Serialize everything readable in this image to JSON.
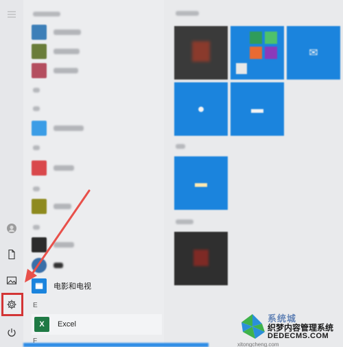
{
  "start_menu": {
    "app_list": {
      "letter_e": "E",
      "letter_f": "F",
      "items": [
        {
          "label": "",
          "icon": "app-icon",
          "color": "#3d7fb8"
        },
        {
          "label": "",
          "icon": "app-icon",
          "color": "#6a7d3a"
        },
        {
          "label": "",
          "icon": "app-icon",
          "color": "#b44e5f"
        },
        {
          "label": "",
          "icon": "app-icon",
          "color": "#3b9de6"
        },
        {
          "label": "",
          "icon": "app-icon",
          "color": "#d9484c"
        },
        {
          "label": "",
          "icon": "app-icon",
          "color": "#8e8a1e"
        },
        {
          "label": "",
          "icon": "app-icon",
          "color": "#2b2b2b"
        },
        {
          "label": "",
          "icon": "app-icon",
          "color": "#3a6fa8"
        },
        {
          "label": "电影和电视",
          "icon": "movies-icon",
          "color": "#1b84dd"
        }
      ],
      "excel_label": "Excel",
      "excel_icon_text": "X"
    },
    "rail": {
      "icons": [
        "menu-icon",
        "user-icon",
        "document-icon",
        "pictures-icon",
        "settings-icon",
        "power-icon"
      ]
    },
    "highlight_color": "#d33535",
    "accent_color": "#1b84dd"
  },
  "watermark": {
    "line1": "系统城",
    "line2": "织梦内容管理系统",
    "line3": "DEDECMS.COM",
    "line4": "xitongcheng.com"
  }
}
